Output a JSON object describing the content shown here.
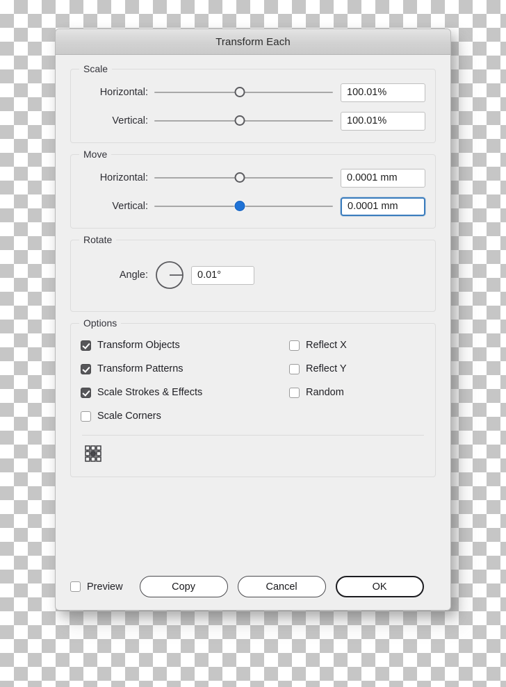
{
  "window": {
    "title": "Transform Each"
  },
  "scale": {
    "legend": "Scale",
    "horizontal_label": "Horizontal:",
    "horizontal_value": "100.01%",
    "vertical_label": "Vertical:",
    "vertical_value": "100.01%"
  },
  "move": {
    "legend": "Move",
    "horizontal_label": "Horizontal:",
    "horizontal_value": "0.0001 mm",
    "vertical_label": "Vertical:",
    "vertical_value": "0.0001 mm"
  },
  "rotate": {
    "legend": "Rotate",
    "angle_label": "Angle:",
    "angle_value": "0.01°"
  },
  "options": {
    "legend": "Options",
    "left_column": [
      {
        "label": "Transform Objects",
        "checked": true
      },
      {
        "label": "Transform Patterns",
        "checked": true
      },
      {
        "label": "Scale Strokes & Effects",
        "checked": true
      },
      {
        "label": "Scale Corners",
        "checked": false
      }
    ],
    "right_column": [
      {
        "label": "Reflect X",
        "checked": false
      },
      {
        "label": "Reflect Y",
        "checked": false
      },
      {
        "label": "Random",
        "checked": false
      }
    ]
  },
  "footer": {
    "preview_label": "Preview",
    "preview_checked": false,
    "copy_label": "Copy",
    "cancel_label": "Cancel",
    "ok_label": "OK"
  },
  "colors": {
    "accent_blue": "#1f72d6",
    "focus_border": "#3a7cbd",
    "checkbox_on": "#565659",
    "dialog_bg": "#efefef",
    "titlebar_top": "#e4e4e4",
    "titlebar_bottom": "#cacaca"
  }
}
